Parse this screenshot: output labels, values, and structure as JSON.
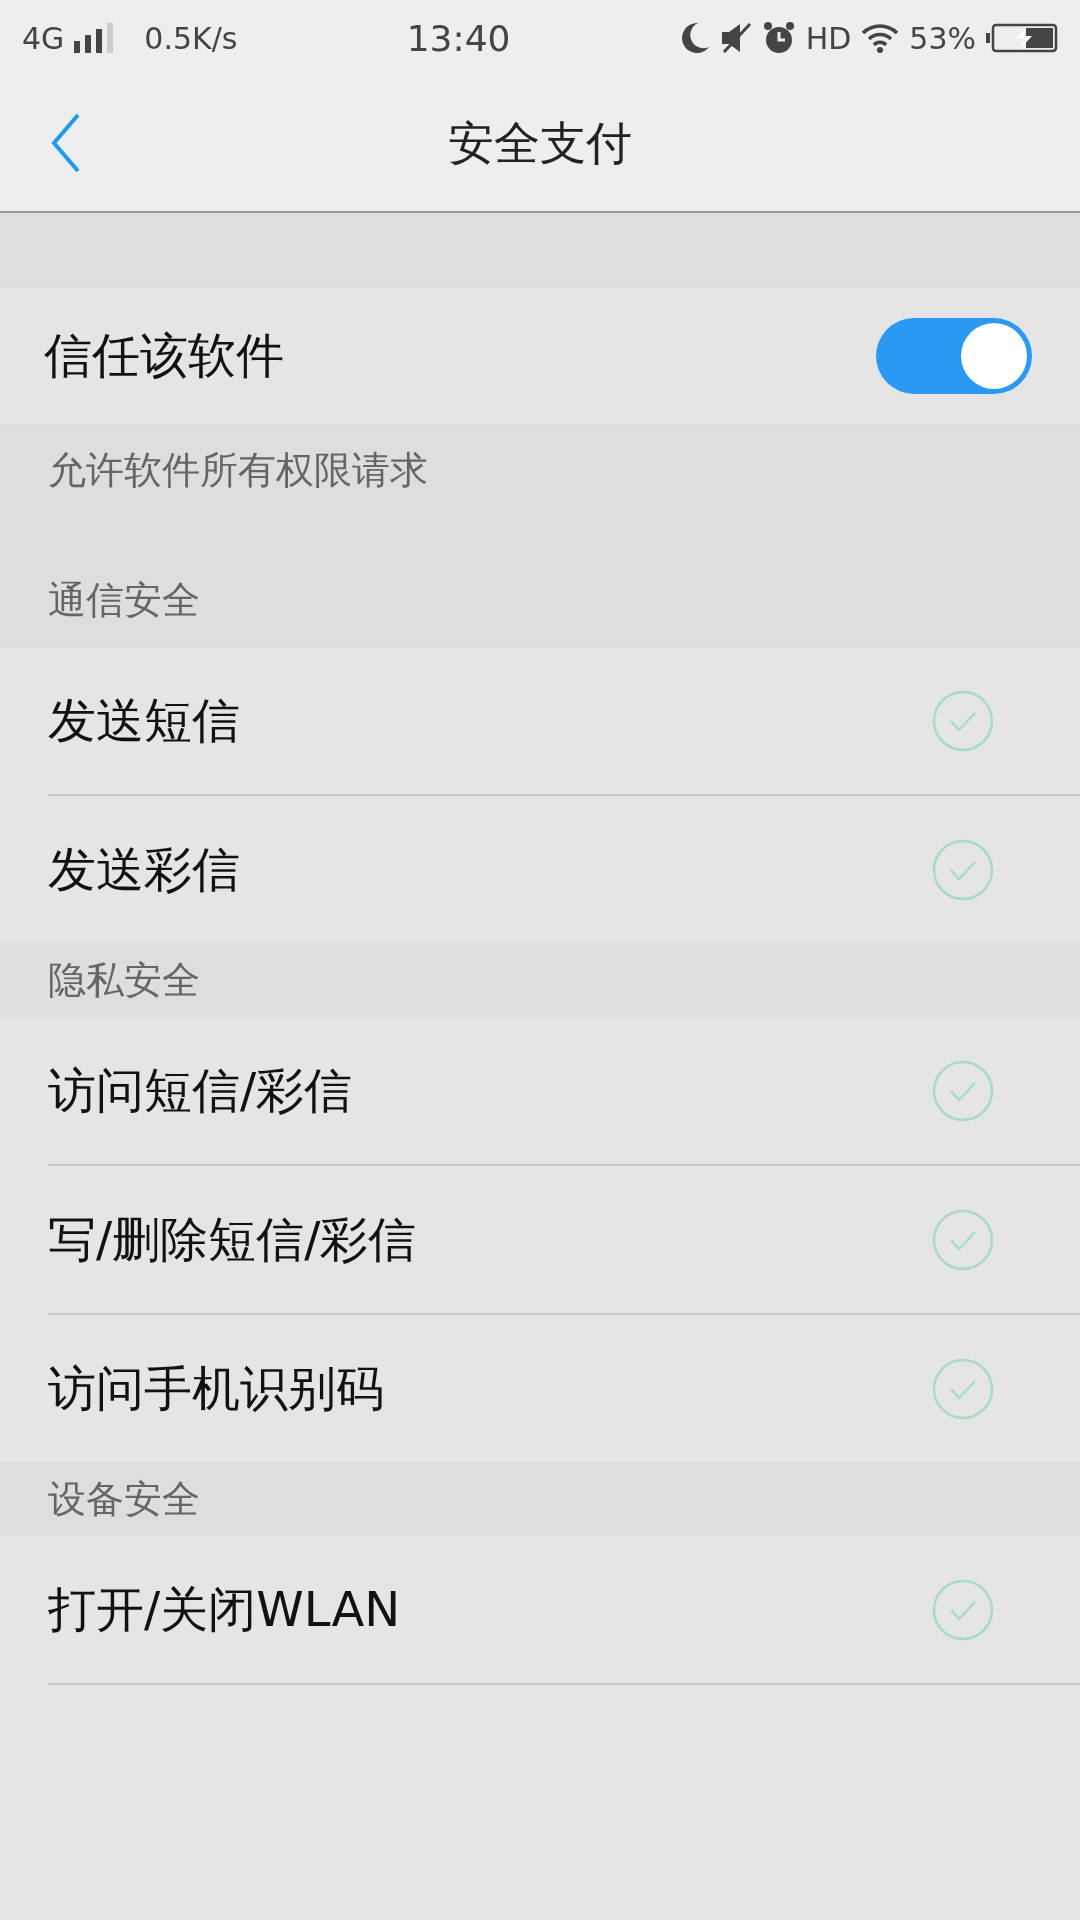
{
  "status_bar": {
    "network": "4G",
    "speed": "0.5K/s",
    "time": "13:40",
    "hd": "HD",
    "battery": "53%"
  },
  "header": {
    "title": "安全支付"
  },
  "trust": {
    "label": "信任该软件",
    "on": true,
    "description": "允许软件所有权限请求"
  },
  "sections": [
    {
      "title": "通信安全",
      "items": [
        {
          "label": "发送短信",
          "checked": true
        },
        {
          "label": "发送彩信",
          "checked": true
        }
      ]
    },
    {
      "title": "隐私安全",
      "items": [
        {
          "label": "访问短信/彩信",
          "checked": true
        },
        {
          "label": "写/删除短信/彩信",
          "checked": true
        },
        {
          "label": "访问手机识别码",
          "checked": true
        }
      ]
    },
    {
      "title": "设备安全",
      "items": [
        {
          "label": "打开/关闭WLAN",
          "checked": true
        }
      ]
    }
  ]
}
